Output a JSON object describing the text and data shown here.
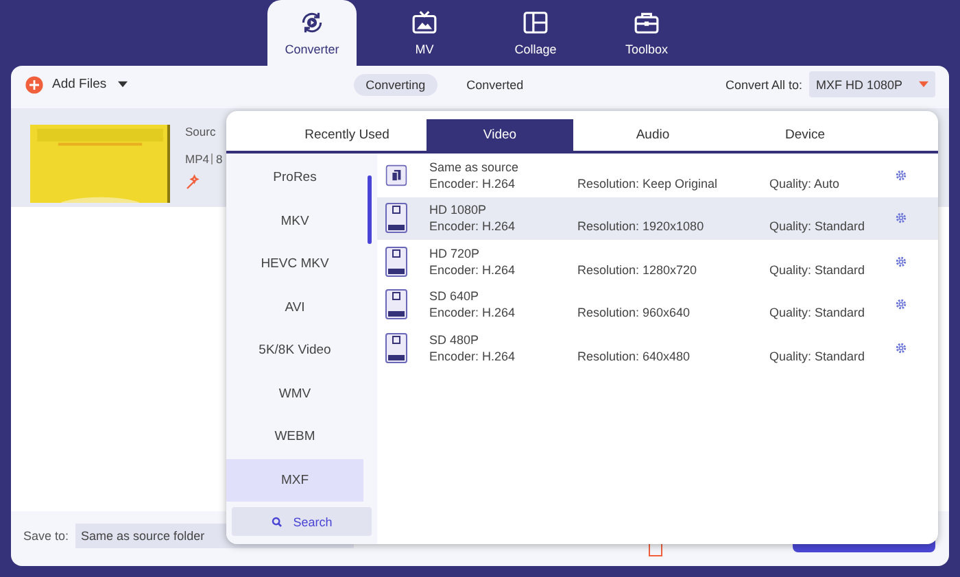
{
  "nav_tabs": [
    {
      "label": "Converter",
      "selected": true
    },
    {
      "label": "MV",
      "selected": false
    },
    {
      "label": "Collage",
      "selected": false
    },
    {
      "label": "Toolbox",
      "selected": false
    }
  ],
  "toolbar": {
    "add_files": "Add Files",
    "view_tabs": [
      {
        "label": "Converting",
        "selected": true
      },
      {
        "label": "Converted",
        "selected": false
      }
    ],
    "convert_all_label": "Convert All to:",
    "convert_all_value": "MXF HD 1080P"
  },
  "file_item": {
    "source_label": "Sourc",
    "format": "MP4",
    "size_partial": "8"
  },
  "bottom_bar": {
    "save_to_label": "Save to:",
    "save_to_value": "Same as source folder",
    "merge_checked": false
  },
  "format_popup": {
    "tabs": [
      {
        "label": "Recently Used",
        "selected": false
      },
      {
        "label": "Video",
        "selected": true
      },
      {
        "label": "Audio",
        "selected": false
      },
      {
        "label": "Device",
        "selected": false
      }
    ],
    "formats": [
      {
        "label": "ProRes",
        "selected": false
      },
      {
        "label": "MKV",
        "selected": false
      },
      {
        "label": "HEVC MKV",
        "selected": false
      },
      {
        "label": "AVI",
        "selected": false
      },
      {
        "label": "5K/8K Video",
        "selected": false
      },
      {
        "label": "WMV",
        "selected": false
      },
      {
        "label": "WEBM",
        "selected": false
      },
      {
        "label": "MXF",
        "selected": true
      }
    ],
    "search_label": "Search",
    "presets": [
      {
        "kind": "source",
        "name": "Same as source",
        "encoder": "Encoder: H.264",
        "resolution": "Resolution: Keep Original",
        "quality": "Quality: Auto",
        "selected": false
      },
      {
        "kind": "video",
        "name": "HD 1080P",
        "encoder": "Encoder: H.264",
        "resolution": "Resolution: 1920x1080",
        "quality": "Quality: Standard",
        "selected": true
      },
      {
        "kind": "video",
        "name": "HD 720P",
        "encoder": "Encoder: H.264",
        "resolution": "Resolution: 1280x720",
        "quality": "Quality: Standard",
        "selected": false
      },
      {
        "kind": "video",
        "name": "SD 640P",
        "encoder": "Encoder: H.264",
        "resolution": "Resolution: 960x640",
        "quality": "Quality: Standard",
        "selected": false
      },
      {
        "kind": "video",
        "name": "SD 480P",
        "encoder": "Encoder: H.264",
        "resolution": "Resolution: 640x480",
        "quality": "Quality: Standard",
        "selected": false
      }
    ]
  }
}
